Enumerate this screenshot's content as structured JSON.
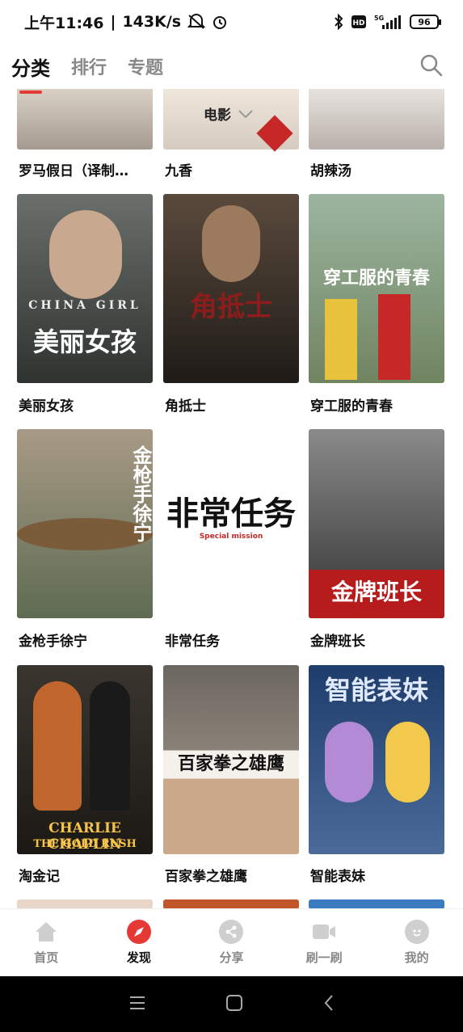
{
  "status": {
    "time": "上午11:46",
    "speed": "143K/s",
    "battery": "96",
    "network": "5G"
  },
  "tabs": [
    {
      "label": "分类",
      "active": true
    },
    {
      "label": "排行",
      "active": false
    },
    {
      "label": "专题",
      "active": false
    }
  ],
  "filter": {
    "label": "电影"
  },
  "partial_row": [
    {
      "title": "罗马假日（译制…"
    },
    {
      "title": "九香"
    },
    {
      "title": "胡辣汤"
    }
  ],
  "movies": [
    {
      "title": "美丽女孩",
      "poster_text": "美丽女孩",
      "poster_sub": "CHINA GIRL",
      "bg": "#4a4f4f"
    },
    {
      "title": "角抵士",
      "poster_text": "角抵士",
      "poster_sub": "",
      "bg": "#3a3530"
    },
    {
      "title": "穿工服的青春",
      "poster_text": "穿工服的青春",
      "poster_sub": "",
      "bg": "#7a8a6a"
    },
    {
      "title": "金枪手徐宁",
      "poster_text": "金枪手徐宁",
      "poster_sub": "",
      "bg": "#8a7a60"
    },
    {
      "title": "非常任务",
      "poster_text": "非常任务",
      "poster_sub": "Special mission",
      "bg": "#ffffff"
    },
    {
      "title": "金牌班长",
      "poster_text": "金牌班长",
      "poster_sub": "",
      "bg": "#4a4a4a"
    },
    {
      "title": "淘金记",
      "poster_text": "CHARLIE CHAPLIN",
      "poster_sub": "THE GOLD RUSH",
      "bg": "#2e2a26"
    },
    {
      "title": "百家拳之雄鹰",
      "poster_text": "百家拳之雄鹰",
      "poster_sub": "",
      "bg": "#6f6a62"
    },
    {
      "title": "智能表妹",
      "poster_text": "智能表妹",
      "poster_sub": "",
      "bg": "#2c4a7a"
    }
  ],
  "bottom_nav": [
    {
      "label": "首页",
      "icon": "home-icon",
      "active": false
    },
    {
      "label": "发现",
      "icon": "compass-icon",
      "active": true
    },
    {
      "label": "分享",
      "icon": "share-icon",
      "active": false
    },
    {
      "label": "刷一刷",
      "icon": "video-icon",
      "active": false
    },
    {
      "label": "我的",
      "icon": "user-icon",
      "active": false
    }
  ],
  "colors": {
    "accent": "#e53935",
    "inactive": "#cfcfcf"
  }
}
